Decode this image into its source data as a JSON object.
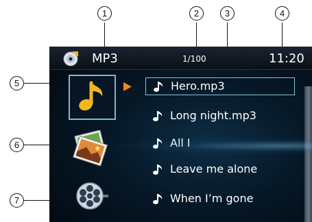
{
  "callouts": [
    "1",
    "2",
    "3",
    "4",
    "5",
    "6",
    "7"
  ],
  "status_bar": {
    "source_icon": "disc-icon",
    "title": "MP3",
    "track_counter": "1/100",
    "time": "11:20"
  },
  "categories": [
    {
      "name": "music",
      "icon": "music-note-icon",
      "selected": true
    },
    {
      "name": "photos",
      "icon": "photos-icon",
      "selected": false
    },
    {
      "name": "video",
      "icon": "film-reel-icon",
      "selected": false
    }
  ],
  "file_list": {
    "playing_indicator": "play-arrow-icon",
    "item_icon": "music-note-icon",
    "items": [
      {
        "label": "Hero.mp3",
        "selected": true
      },
      {
        "label": "Long night.mp3",
        "selected": false
      },
      {
        "label": "All I",
        "selected": false
      },
      {
        "label": "Leave me alone",
        "selected": false
      },
      {
        "label": "When I’m gone",
        "selected": false
      }
    ]
  },
  "colors": {
    "screen_background": "#061827",
    "highlight_border": "#8ac3d2",
    "music_icon": "#f2b61f",
    "play_arrow": "#f08a18",
    "text": "#ffffff"
  }
}
